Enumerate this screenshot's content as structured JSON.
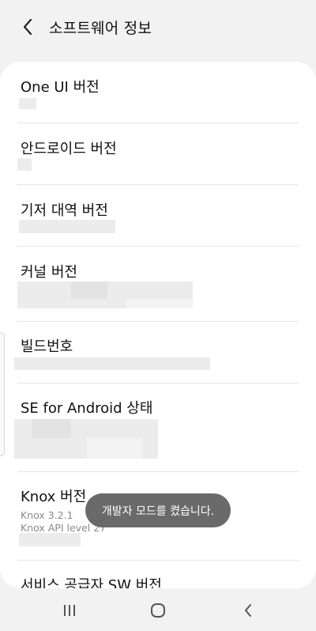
{
  "header": {
    "title": "소프트웨어 정보",
    "back_icon": "chevron-left-icon"
  },
  "items": [
    {
      "title": "One UI 버전"
    },
    {
      "title": "안드로이드 버전"
    },
    {
      "title": "기저 대역 버전"
    },
    {
      "title": "커널 버전"
    },
    {
      "title": "빌드번호"
    },
    {
      "title": "SE for Android 상태"
    },
    {
      "title": "Knox 버전",
      "sub_lines": [
        "Knox 3.2.1",
        "Knox API level 27"
      ]
    },
    {
      "title": "서비스 공급자 SW 버전"
    }
  ],
  "toast": {
    "message": "개발자 모드를 켰습니다."
  },
  "navbar": {
    "recents_icon": "recents-icon",
    "home_icon": "home-icon",
    "back_icon": "back-icon"
  },
  "colors": {
    "background": "#f2f2f2",
    "card": "#ffffff",
    "toast": "#6a6a6a"
  }
}
